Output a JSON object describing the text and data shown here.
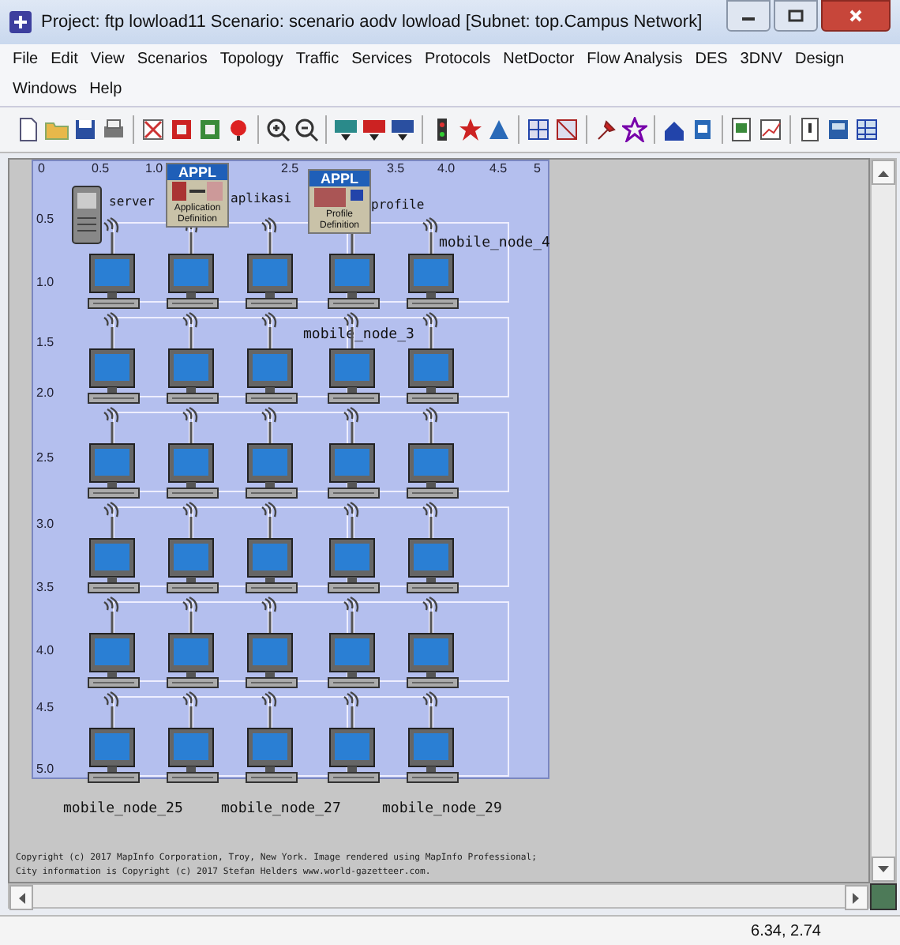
{
  "window": {
    "title": "Project: ftp lowload11 Scenario: scenario aodv lowload  [Subnet: top.Campus Network]"
  },
  "menu": [
    "File",
    "Edit",
    "View",
    "Scenarios",
    "Topology",
    "Traffic",
    "Services",
    "Protocols",
    "NetDoctor",
    "Flow Analysis",
    "DES",
    "3DNV",
    "Design",
    "Windows",
    "Help"
  ],
  "canvas": {
    "x_ticks": [
      "0",
      "0.5",
      "1.0",
      "2.5",
      "3.5",
      "4.0",
      "4.5",
      "5"
    ],
    "y_ticks": [
      "0.5",
      "1.0",
      "1.5",
      "2.0",
      "2.5",
      "3.0",
      "3.5",
      "4.0",
      "4.5",
      "5.0"
    ],
    "config_nodes": [
      {
        "kind": "server",
        "label": "server"
      },
      {
        "kind": "application",
        "badge": "APPL",
        "caption": "Application Definition",
        "label": "aplikasi"
      },
      {
        "kind": "profile",
        "badge": "APPL",
        "caption": "Profile Definition",
        "label": "profile"
      }
    ],
    "node_rows": [
      {
        "nodes": [
          {
            "kind": "workstation"
          },
          {
            "kind": "workstation"
          },
          {
            "kind": "workstation"
          },
          {
            "kind": "workstation",
            "label": "mobile_node_3"
          },
          {
            "kind": "workstation",
            "label": "mobile_node_4"
          }
        ]
      },
      {
        "nodes": [
          {
            "kind": "workstation"
          },
          {
            "kind": "workstation"
          },
          {
            "kind": "workstation"
          },
          {
            "kind": "workstation"
          },
          {
            "kind": "workstation"
          }
        ]
      },
      {
        "nodes": [
          {
            "kind": "workstation"
          },
          {
            "kind": "workstation"
          },
          {
            "kind": "workstation"
          },
          {
            "kind": "workstation"
          },
          {
            "kind": "workstation"
          }
        ]
      },
      {
        "nodes": [
          {
            "kind": "workstation"
          },
          {
            "kind": "workstation"
          },
          {
            "kind": "workstation"
          },
          {
            "kind": "workstation"
          },
          {
            "kind": "workstation"
          }
        ]
      },
      {
        "nodes": [
          {
            "kind": "workstation"
          },
          {
            "kind": "workstation"
          },
          {
            "kind": "workstation"
          },
          {
            "kind": "workstation"
          },
          {
            "kind": "workstation"
          }
        ]
      },
      {
        "nodes": [
          {
            "kind": "workstation",
            "label": "mobile_node_25"
          },
          {
            "kind": "workstation"
          },
          {
            "kind": "workstation",
            "label": "mobile_node_27"
          },
          {
            "kind": "workstation"
          },
          {
            "kind": "workstation",
            "label": "mobile_node_29"
          }
        ]
      }
    ],
    "copyright": [
      "Copyright (c) 2017 MapInfo Corporation, Troy, New York. Image rendered using MapInfo Professional;",
      "City information is Copyright (c) 2017 Stefan Helders www.world-gazetteer.com."
    ]
  },
  "status_bar": {
    "coordinates": "6.34, 2.74"
  }
}
